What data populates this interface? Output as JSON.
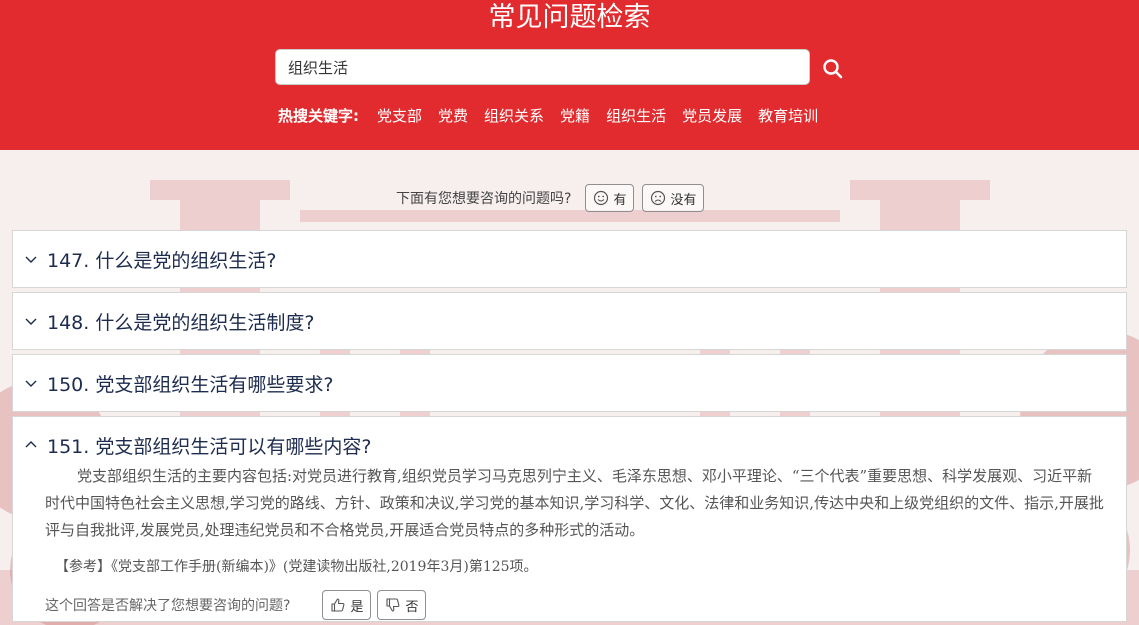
{
  "header": {
    "title": "常见问题检索",
    "search_value": "组织生活",
    "search_icon": "search-icon",
    "hot_label": "热搜关键字:",
    "hot_keywords": [
      "党支部",
      "党费",
      "组织关系",
      "党籍",
      "组织生活",
      "党员发展",
      "教育培训"
    ],
    "bg_color": "#e12b2e"
  },
  "prompt": {
    "text": "下面有您想要咨询的问题吗?",
    "yes_label": "有",
    "no_label": "没有"
  },
  "faqs": [
    {
      "title": "147. 什么是党的组织生活?",
      "expanded": false
    },
    {
      "title": "148. 什么是党的组织生活制度?",
      "expanded": false
    },
    {
      "title": "150. 党支部组织生活有哪些要求?",
      "expanded": false
    },
    {
      "title": "151. 党支部组织生活可以有哪些内容?",
      "expanded": true,
      "answer": "党支部组织生活的主要内容包括:对党员进行教育,组织党员学习马克思列宁主义、毛泽东思想、邓小平理论、“三个代表”重要思想、科学发展观、习近平新时代中国特色社会主义思想,学习党的路线、方针、政策和决议,学习党的基本知识,学习科学、文化、法律和业务知识,传达中央和上级党组织的文件、指示,开展批评与自我批评,发展党员,处理违纪党员和不合格党员,开展适合党员特点的多种形式的活动。",
      "reference": "【参考】《党支部工作手册(新编本)》(党建读物出版社,2019年3月)第125项。",
      "feedback_text": "这个回答是否解决了您想要咨询的问题?",
      "feedback_yes": "是",
      "feedback_no": "否"
    }
  ]
}
